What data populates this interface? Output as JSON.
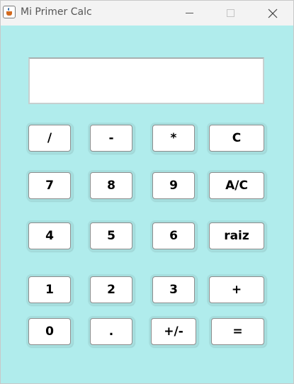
{
  "window": {
    "title": "Mi Primer Calc",
    "controls": [
      "minimize-icon",
      "maximize-icon",
      "close-icon"
    ]
  },
  "display": {
    "value": ""
  },
  "keys": {
    "divide": "/",
    "subtract": "-",
    "multiply": "*",
    "clear": "C",
    "seven": "7",
    "eight": "8",
    "nine": "9",
    "all_clear": "A/C",
    "four": "4",
    "five": "5",
    "six": "6",
    "sqrt": "raiz",
    "one": "1",
    "two": "2",
    "three": "3",
    "add": "+",
    "zero": "0",
    "decimal": ".",
    "negate": "+/-",
    "equals": "="
  },
  "colors": {
    "background": "#b0ecec",
    "titlebar": "#f3f3f3",
    "button": "#ffffff"
  }
}
